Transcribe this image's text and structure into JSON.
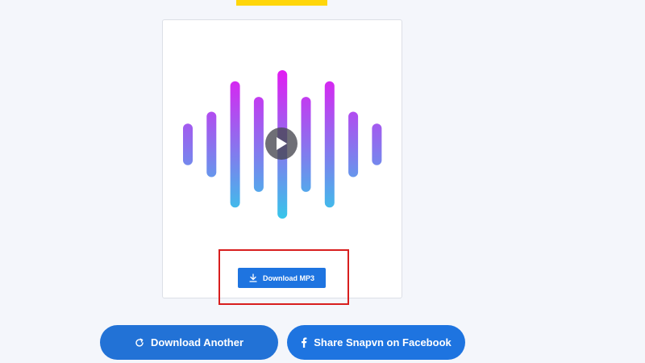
{
  "header": {
    "accent_color": "#ffd60a"
  },
  "player": {
    "waveform_bars": [
      0.28,
      0.44,
      0.85,
      0.64,
      1.0,
      0.64,
      0.85,
      0.44,
      0.28
    ],
    "gradient_top": "#e21cf2",
    "gradient_bottom": "#36c6ea",
    "play_icon": "play-icon"
  },
  "download": {
    "label": "Download MP3",
    "icon": "download-icon",
    "highlight_color": "#d81e1e"
  },
  "actions": {
    "download_another": "Download Another",
    "download_another_icon": "refresh-icon",
    "share": "Share Snapvn on Facebook",
    "share_icon": "facebook-icon",
    "button_color": "#1e74e0"
  }
}
